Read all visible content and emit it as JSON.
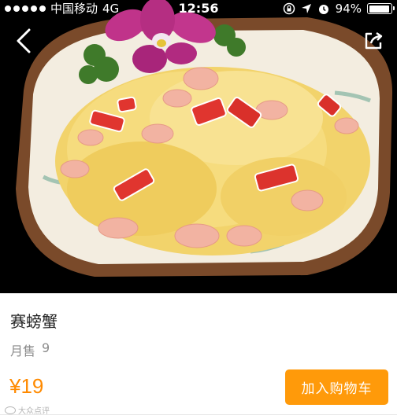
{
  "status_bar": {
    "carrier": "中国移动",
    "network": "4G",
    "time": "12:56",
    "battery": "94%",
    "battery_level": 0.94,
    "signal_dots": 5,
    "icons": [
      "signal-icon",
      "rotation-lock-icon",
      "location-icon",
      "alarm-icon",
      "battery-icon"
    ]
  },
  "nav": {
    "back_icon": "back-chevron-icon",
    "share_icon": "share-icon"
  },
  "hero": {
    "image": "dish-photo"
  },
  "product": {
    "name": "赛螃蟹",
    "sales_label": "月售",
    "sales_count": "9",
    "price": "¥19"
  },
  "actions": {
    "add_to_cart_label": "加入购物车"
  },
  "watermark": {
    "text": "大众点评"
  },
  "colors": {
    "accent": "#ff9a0a",
    "price": "#ff8a00",
    "muted": "#8c8c8c",
    "photo_bg": "#000000"
  }
}
